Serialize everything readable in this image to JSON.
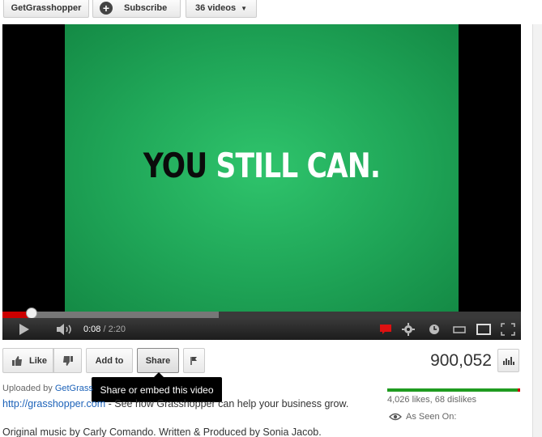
{
  "topbar": {
    "channel_label": "GetGrasshopper",
    "subscribe_label": "Subscribe",
    "videos_label": "36 videos"
  },
  "player": {
    "slogan_dark": "YOU",
    "slogan_light": "STILL CAN.",
    "current_time": "0:08",
    "duration": "/ 2:20",
    "progress_fraction": 0.057
  },
  "actions": {
    "like_label": "Like",
    "addto_label": "Add to",
    "share_label": "Share",
    "tooltip": "Share or embed this video"
  },
  "stats": {
    "views": "900,052",
    "likes_text": "4,026 likes, 68 dislikes",
    "as_seen_on": "As Seen On:",
    "like_ratio": 0.983
  },
  "description": {
    "uploaded_by": "Uploaded by ",
    "uploader_link": "GetGrass",
    "url": "http://grasshopper.com",
    "text": " - See how Grasshopper can help your business grow.",
    "music": "Original music by Carly Comando. Written & Produced by Sonia Jacob."
  },
  "colors": {
    "green": "#1fa557",
    "progress_red": "#cc0000",
    "link_blue": "#1c62b9"
  }
}
